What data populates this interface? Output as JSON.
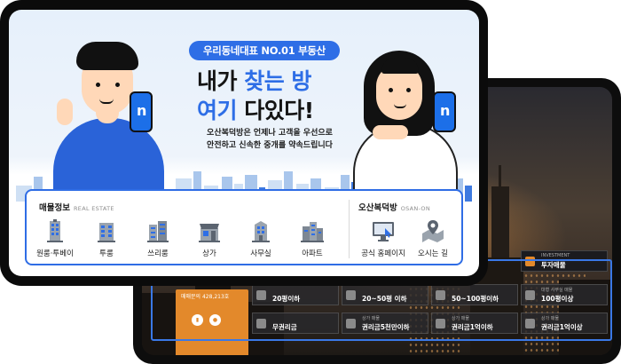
{
  "front": {
    "badge": "우리동네대표 NO.01 부동산",
    "headline": {
      "line1_plain_a": "내가 ",
      "line1_highlight": "찾는 방",
      "line2_highlight": "여기",
      "line2_plain_b": " 다있다!"
    },
    "description": {
      "line1": "오산복덕방은 언제나 고객을 우선으로",
      "line2": "안전하고 신속한 중개를 약속드립니다"
    },
    "phone_logo": "n",
    "panel": {
      "listings": {
        "title": "매물정보",
        "subtitle": "REAL ESTATE",
        "items": [
          {
            "label": "원룸·투베이",
            "icon": "single-building-icon"
          },
          {
            "label": "투룸",
            "icon": "apartment-icon"
          },
          {
            "label": "쓰리룸",
            "icon": "twin-building-icon"
          },
          {
            "label": "상가",
            "icon": "storefront-icon"
          },
          {
            "label": "사무실",
            "icon": "office-icon"
          },
          {
            "label": "아파트",
            "icon": "apartment-complex-icon"
          }
        ]
      },
      "company": {
        "title": "오산복덕방",
        "subtitle": "OSAN-ON",
        "items": [
          {
            "label": "공식 홈페이지",
            "icon": "monitor-icon"
          },
          {
            "label": "오시는 길",
            "icon": "map-pin-icon"
          }
        ]
      }
    }
  },
  "back": {
    "orange_card_text": "매매문의 428,213호",
    "tiles": [
      {
        "sub": "",
        "main": "20평이하"
      },
      {
        "sub": "",
        "main": "20~50평 이하"
      },
      {
        "sub": "",
        "main": "50~100평이하"
      },
      {
        "sub": "대형 사무실 매물",
        "main": "100평이상"
      },
      {
        "sub": "INVESTMENT",
        "main": "투자매물"
      },
      {
        "sub": "",
        "main": "무권리금"
      },
      {
        "sub": "상가 매물",
        "main": "권리금5천만이하"
      },
      {
        "sub": "상가 매물",
        "main": "권리금1억이하"
      },
      {
        "sub": "상가 매물",
        "main": "권리금1억이상"
      }
    ]
  },
  "colors": {
    "primary_blue": "#2e6ee6",
    "accent_orange": "#e3892b",
    "sky_background": "#e6f0fb"
  }
}
